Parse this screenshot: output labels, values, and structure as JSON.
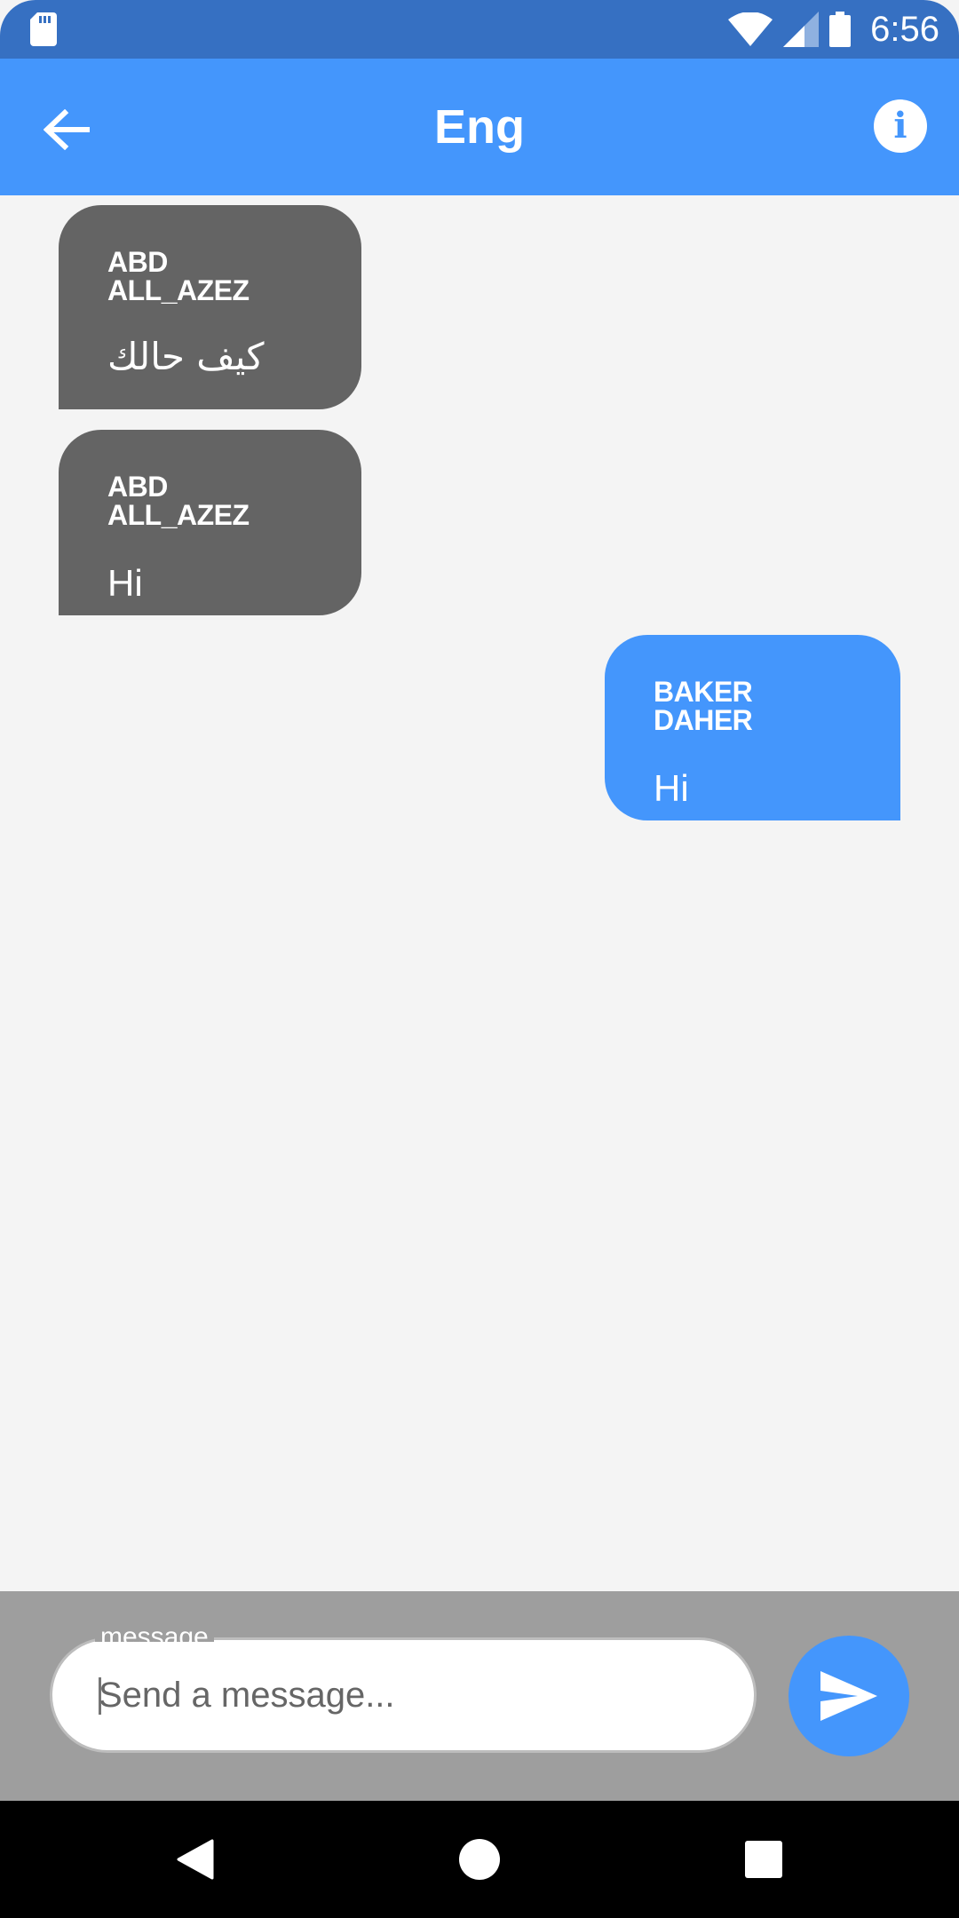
{
  "status_bar": {
    "time": "6:56",
    "icons": [
      "sd-card-icon",
      "wifi-icon",
      "cell-signal-icon",
      "battery-icon"
    ]
  },
  "app_bar": {
    "title": "Eng",
    "back_icon": "arrow-back-icon",
    "info_icon": "info-icon"
  },
  "messages": [
    {
      "sender": "ABD ALL_AZEZ",
      "text": "كيف حالك",
      "direction": "received"
    },
    {
      "sender": "ABD ALL_AZEZ",
      "text": "Hi",
      "direction": "received"
    },
    {
      "sender": "BAKER DAHER",
      "text": "Hi",
      "direction": "sent"
    }
  ],
  "composer": {
    "label": "message",
    "placeholder": "Send a message...",
    "value": "",
    "send_icon": "send-icon"
  },
  "nav_bar": {
    "icons": [
      "nav-back-icon",
      "nav-home-icon",
      "nav-recents-icon"
    ]
  },
  "colors": {
    "status_bar": "#3670c2",
    "primary": "#4496fc",
    "received_bubble": "#646464",
    "background": "#f4f4f4",
    "composer_background": "#9e9e9e"
  }
}
